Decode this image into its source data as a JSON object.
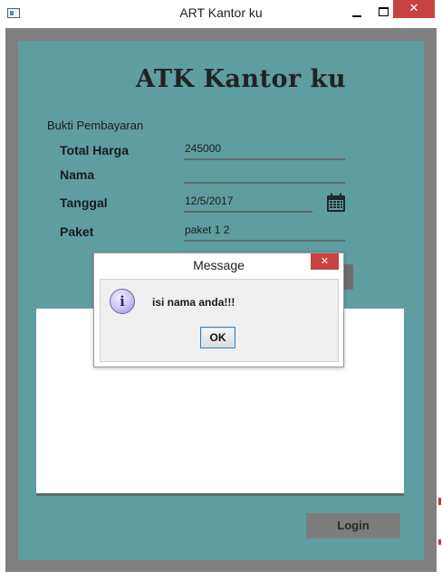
{
  "window": {
    "title": "ART Kantor ku",
    "close_glyph": "✕"
  },
  "app": {
    "heading": "ATK Kantor ku",
    "section_label": "Bukti Pembayaran",
    "fields": {
      "total_harga": {
        "label": "Total Harga",
        "value": "245000"
      },
      "nama": {
        "label": "Nama",
        "value": ""
      },
      "tanggal": {
        "label": "Tanggal",
        "value": "12/5/2017"
      },
      "paket": {
        "label": "Paket",
        "value": "paket 1 2"
      }
    },
    "calendar_icon": "calendar-icon",
    "login_label": "Login"
  },
  "dialog": {
    "title": "Message",
    "message": "isi nama anda!!!",
    "ok_label": "OK",
    "icon": "info-icon",
    "icon_glyph": "i",
    "close_glyph": "✕"
  },
  "colors": {
    "frame": "#808080",
    "panel": "#5f9ea0",
    "close_red": "#c74343"
  }
}
